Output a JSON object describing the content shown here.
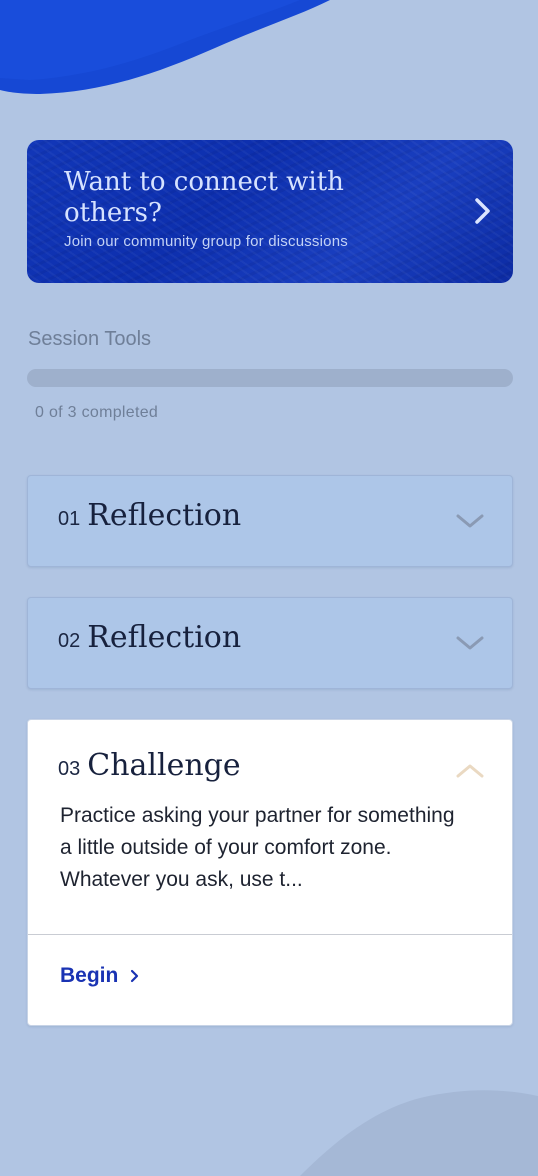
{
  "community": {
    "title": "Want to connect with others?",
    "subtitle": "Join our community group for discussions"
  },
  "session_tools": {
    "title": "Session Tools",
    "completed": 0,
    "total": 3,
    "progress_text": "0 of 3 completed",
    "items": [
      {
        "number": "01",
        "title": "Reflection",
        "expanded": false,
        "icon": "chevron-down-icon"
      },
      {
        "number": "02",
        "title": "Reflection",
        "expanded": false,
        "icon": "chevron-down-icon"
      },
      {
        "number": "03",
        "title": "Challenge",
        "expanded": true,
        "icon": "chevron-up-icon",
        "description": "Practice asking your partner for something a little outside of your comfort zone. Whatever you ask, use t...",
        "action_label": "Begin"
      }
    ]
  },
  "colors": {
    "background": "#b1c5e3",
    "accent": "#1a33b3",
    "chevron_collapsed": "#8a9ab4",
    "chevron_expanded": "#ead9c2"
  }
}
